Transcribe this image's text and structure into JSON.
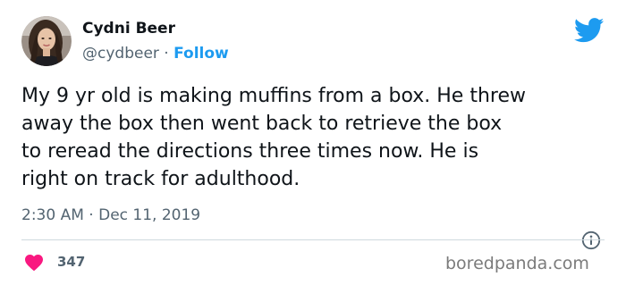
{
  "author": {
    "name": "Cydni Beer",
    "handle": "@cydbeer",
    "separator": " · ",
    "follow_label": "Follow"
  },
  "tweet": {
    "text": "My 9 yr old is making muffins from a box. He threw\naway the box then went back to retrieve the box\nto reread the directions three times now. He is\nright on track for adulthood.",
    "time": "2:30 AM",
    "date_separator": " · ",
    "date": "Dec 11, 2019"
  },
  "engagement": {
    "likes": "347"
  },
  "icons": {
    "brand": "twitter-bird-icon",
    "info": "info-icon",
    "like": "heart-icon"
  },
  "colors": {
    "accent": "#1d9bf0",
    "like": "#f91880",
    "secondary_text": "#536471",
    "divider": "#cfd9de"
  },
  "watermark": {
    "text": "boredpanda.com"
  }
}
